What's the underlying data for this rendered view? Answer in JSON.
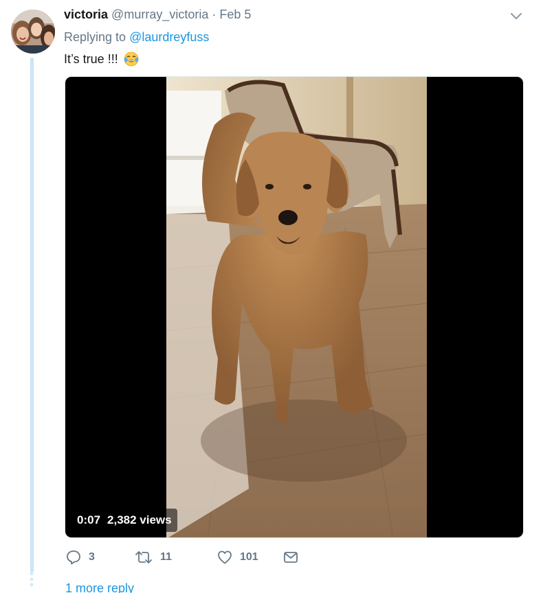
{
  "tweet": {
    "display_name": "victoria",
    "handle": "@murray_victoria",
    "separator": "·",
    "date": "Feb 5",
    "replying_prefix": "Replying to",
    "replying_to": "@laurdreyfuss",
    "text": "It’s true !!!",
    "emoji": "face-with-tears-of-joy-icon"
  },
  "media": {
    "duration": "0:07",
    "views": "2,382 views"
  },
  "actions": {
    "reply_count": "3",
    "retweet_count": "11",
    "like_count": "101",
    "reply_icon": "reply-icon",
    "retweet_icon": "retweet-icon",
    "like_icon": "heart-icon",
    "message_icon": "envelope-icon"
  },
  "thread": {
    "more_replies_label": "1 more reply"
  },
  "colors": {
    "link": "#1b95e0",
    "secondary_text": "#657786",
    "primary_text": "#14171a",
    "thread_line": "#cfe6f7"
  }
}
